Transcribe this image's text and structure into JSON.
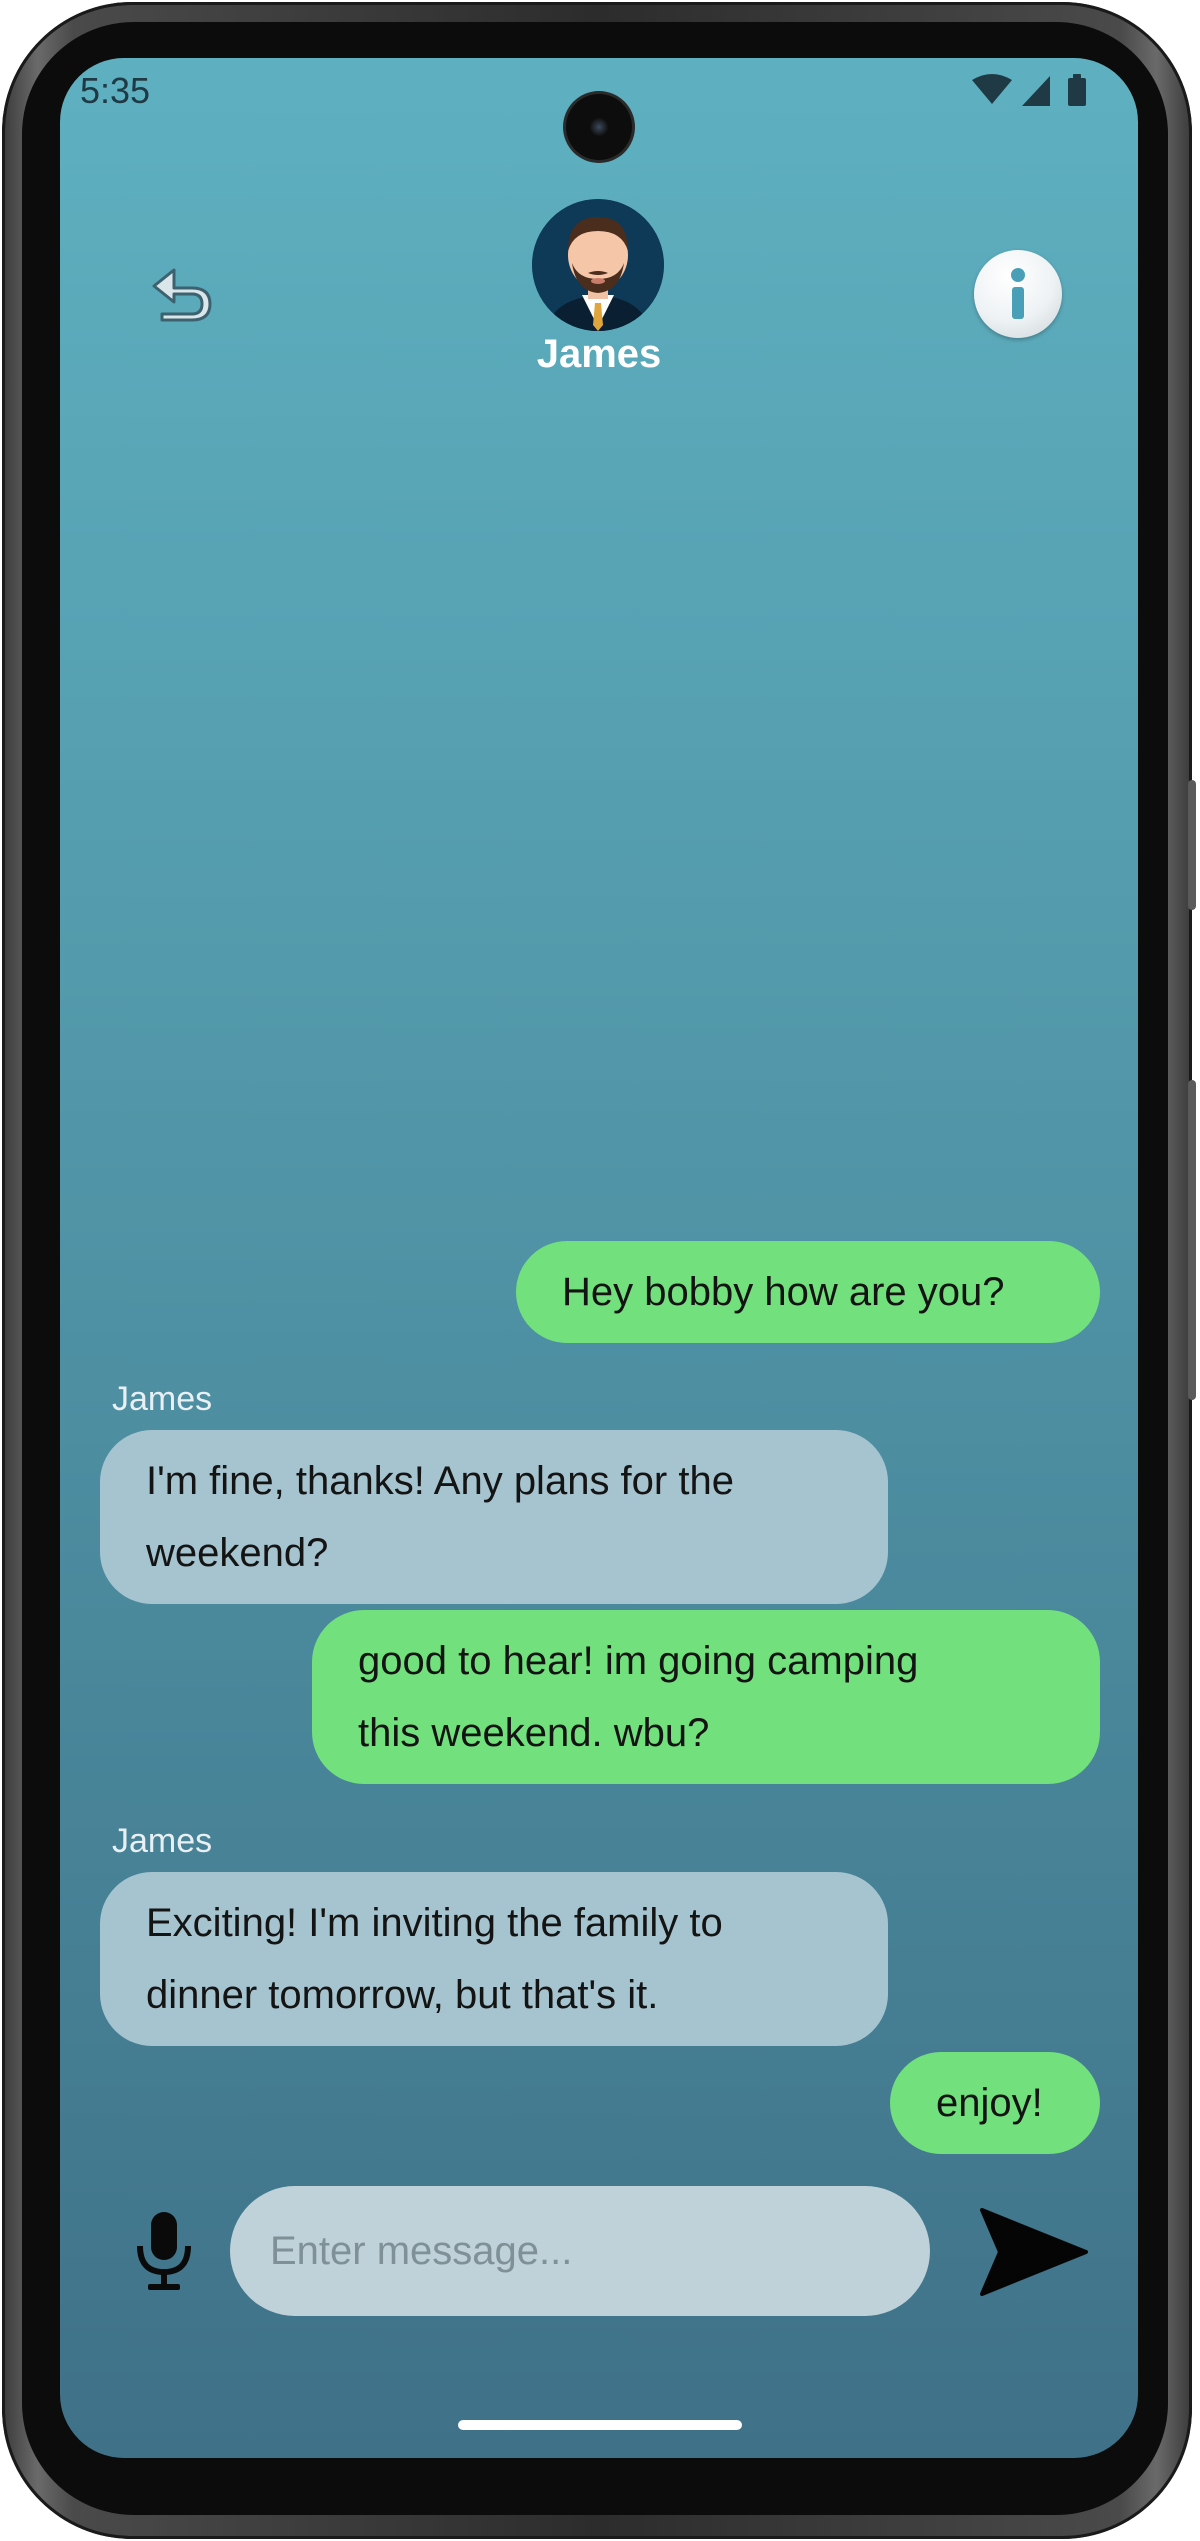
{
  "status_bar": {
    "time": "5:35",
    "icons": [
      "wifi-icon",
      "signal-icon",
      "battery-icon"
    ]
  },
  "header": {
    "back_icon": "undo-arrow-icon",
    "contact_name": "James",
    "avatar": "man-with-beard-avatar",
    "info_icon": "info-icon"
  },
  "messages": [
    {
      "type": "sent",
      "text": "Hey bobby how are you?"
    },
    {
      "type": "received",
      "sender": "James",
      "lines": [
        "I'm fine, thanks! Any plans for the",
        "weekend?"
      ]
    },
    {
      "type": "sent",
      "lines": [
        "good to hear! im going camping",
        "this weekend. wbu?"
      ]
    },
    {
      "type": "received",
      "sender": "James",
      "lines": [
        "Exciting! I'm inviting the family to",
        "dinner tomorrow, but that's it."
      ]
    },
    {
      "type": "sent",
      "text": "enjoy!"
    }
  ],
  "composer": {
    "mic_icon": "microphone-icon",
    "placeholder": "Enter message...",
    "value": "",
    "send_icon": "send-icon"
  },
  "colors": {
    "sent_bubble": "#72e07d",
    "received_bubble": "#a6c4cf",
    "input_bg": "#bfd2d9",
    "background_top": "#5eb0c0",
    "background_bottom": "#3f7188"
  }
}
